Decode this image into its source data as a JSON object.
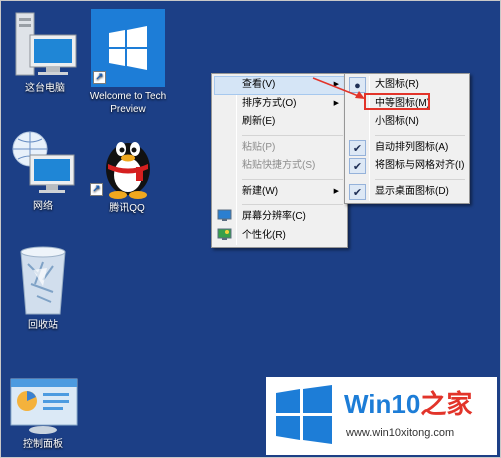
{
  "desktop_icons": {
    "this_pc": "这台电脑",
    "welcome": "Welcome to Tech Preview",
    "network": "网络",
    "qq": "腾讯QQ",
    "recycle_bin": "回收站",
    "control_panel": "控制面板"
  },
  "context_menu": {
    "items": [
      {
        "label": "查看(V)",
        "submenu": true,
        "highlighted": true
      },
      {
        "label": "排序方式(O)",
        "submenu": true
      },
      {
        "label": "刷新(E)"
      },
      {
        "label": "粘贴(P)",
        "disabled": true
      },
      {
        "label": "粘贴快捷方式(S)",
        "disabled": true
      },
      {
        "label": "新建(W)",
        "submenu": true
      },
      {
        "label": "屏幕分辨率(C)",
        "icon": "display-icon"
      },
      {
        "label": "个性化(R)",
        "icon": "personalize-icon"
      }
    ]
  },
  "view_submenu": {
    "items": [
      {
        "label": "大图标(R)",
        "mark": "dot"
      },
      {
        "label": "中等图标(M)",
        "annotated": true
      },
      {
        "label": "小图标(N)"
      },
      {
        "label": "自动排列图标(A)",
        "mark": "check"
      },
      {
        "label": "将图标与网格对齐(I)",
        "mark": "check"
      },
      {
        "label": "显示桌面图标(D)",
        "mark": "check"
      }
    ]
  },
  "watermark": {
    "brand": "Win10",
    "brand_suffix": "之家",
    "url": "www.win10xitong.com"
  },
  "colors": {
    "desktop": "#1c3f86",
    "annotation": "#e2342a",
    "win_blue": "#1d7dd7"
  }
}
